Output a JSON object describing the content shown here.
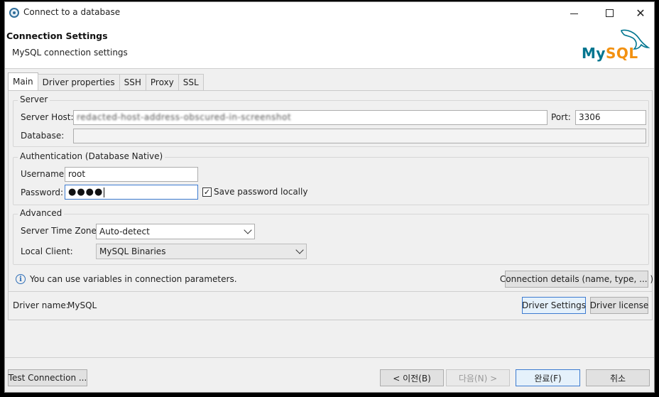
{
  "window": {
    "title": "Connect to a database",
    "controls": {
      "minimize": "minimize-icon",
      "maximize": "maximize-icon",
      "close": "✕"
    }
  },
  "header": {
    "title": "Connection Settings",
    "subtitle": "MySQL connection settings",
    "logo_my": "My",
    "logo_sql": "SQL",
    "brand_colors": {
      "my": "#00758f",
      "sql": "#f29111"
    }
  },
  "tabs": [
    {
      "label": "Main",
      "active": true
    },
    {
      "label": "Driver properties",
      "active": false
    },
    {
      "label": "SSH",
      "active": false
    },
    {
      "label": "Proxy",
      "active": false
    },
    {
      "label": "SSL",
      "active": false
    }
  ],
  "server": {
    "group_title": "Server",
    "host_label": "Server Host:",
    "host_value": "redacted-host-address-obscured-in-screenshot",
    "port_label": "Port:",
    "port_value": "3306",
    "database_label": "Database:",
    "database_value": ""
  },
  "auth": {
    "group_title": "Authentication (Database Native)",
    "username_label": "Username:",
    "username_value": "root",
    "password_label": "Password:",
    "password_value": "●●●●",
    "save_password_label": "Save password locally",
    "save_password_checked": true,
    "check_mark": "✓"
  },
  "advanced": {
    "group_title": "Advanced",
    "timezone_label": "Server Time Zone:",
    "timezone_value": "Auto-detect",
    "client_label": "Local Client:",
    "client_value": "MySQL Binaries"
  },
  "info": {
    "icon_char": "i",
    "text": "You can use variables in connection parameters.",
    "details_button": "Connection details (name, type, ... )"
  },
  "driver": {
    "name_label": "Driver name:",
    "name_value": "MySQL",
    "settings_button": "Driver Settings",
    "license_button": "Driver license"
  },
  "footer": {
    "test_button": "Test Connection ...",
    "back_button": "< 이전(B)",
    "next_button": "다음(N) >",
    "finish_button": "완료(F)",
    "cancel_button": "취소"
  }
}
